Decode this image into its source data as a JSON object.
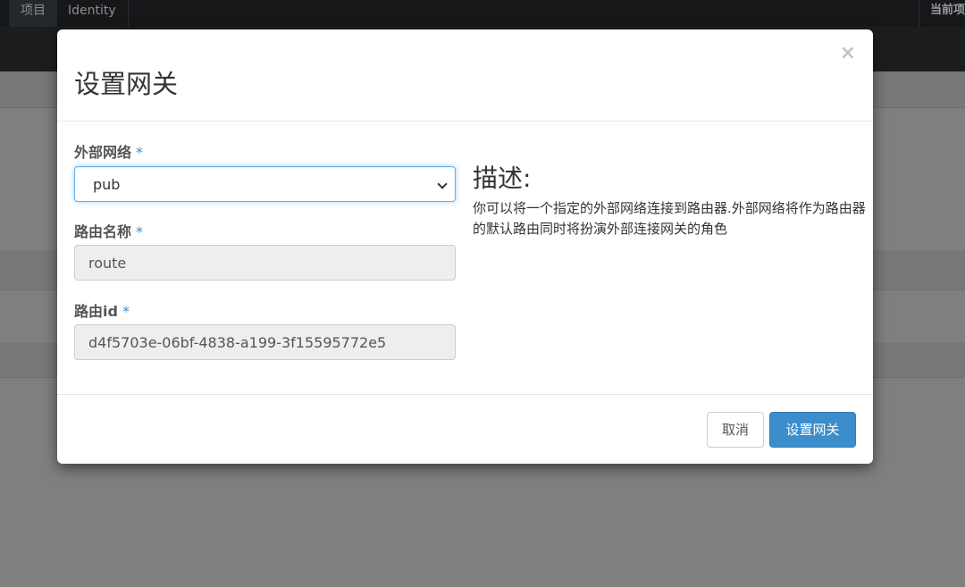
{
  "topnav": {
    "tabs": [
      {
        "label": "项目"
      },
      {
        "label": "Identity"
      }
    ],
    "right_label": "当前项"
  },
  "modal": {
    "title": "设置网关",
    "close_icon": "close-icon",
    "fields": {
      "external_network": {
        "label": "外部网络",
        "required_mark": "*",
        "value": "pub"
      },
      "router_name": {
        "label": "路由名称",
        "required_mark": "*",
        "value": "route"
      },
      "router_id": {
        "label": "路由id",
        "required_mark": "*",
        "value": "d4f5703e-06bf-4838-a199-3f15595772e5"
      }
    },
    "description": {
      "title": "描述:",
      "text": "你可以将一个指定的外部网络连接到路由器.外部网络将作为路由器的默认路由同时将扮演外部连接网关的角色"
    },
    "footer": {
      "cancel_label": "取消",
      "submit_label": "设置网关"
    }
  },
  "colors": {
    "primary": "#3c8dcb",
    "overlay": "#7f7f7f"
  }
}
